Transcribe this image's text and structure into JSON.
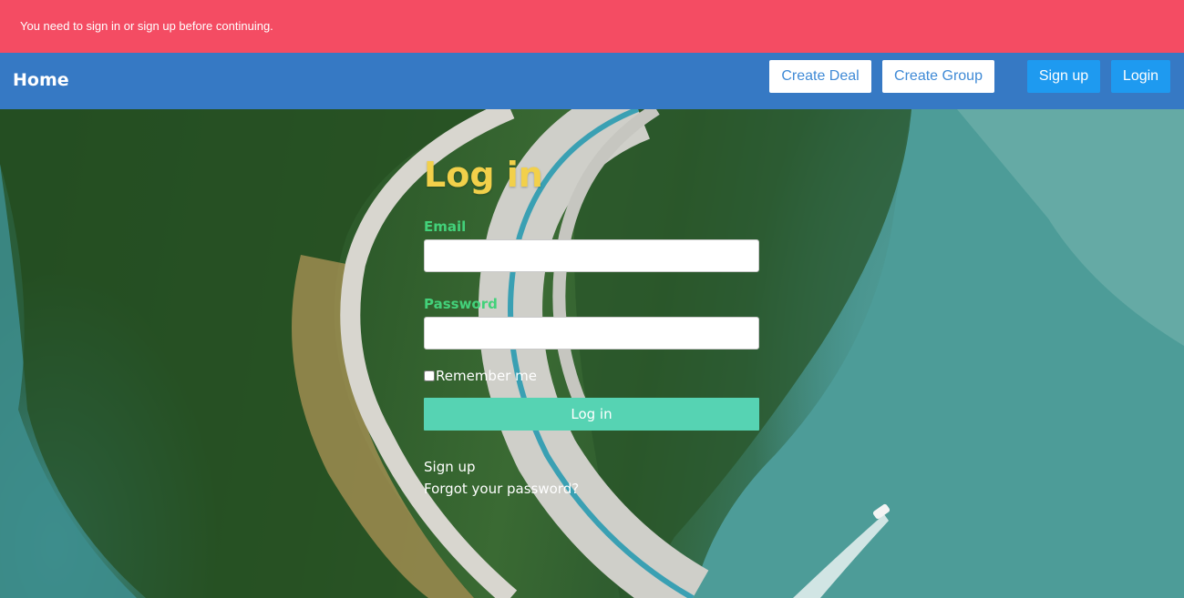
{
  "alert": {
    "message": "You need to sign in or sign up before continuing."
  },
  "navbar": {
    "brand": "Home",
    "create_deal": "Create Deal",
    "create_group": "Create Group",
    "sign_up": "Sign up",
    "login": "Login"
  },
  "login_form": {
    "title": "Log in",
    "email_label": "Email",
    "email_value": "",
    "password_label": "Password",
    "password_value": "",
    "remember_label": "Remember me",
    "remember_checked": false,
    "submit_label": "Log in",
    "sign_up_link": "Sign up",
    "forgot_password_link": "Forgot your password?"
  },
  "colors": {
    "alert_bg": "#f44c63",
    "navbar_bg": "#3679c4",
    "title": "#f2d04a",
    "field_label": "#43d17a",
    "submit_bg": "#56d3b3",
    "nav_button_blue": "#1e9af0"
  }
}
